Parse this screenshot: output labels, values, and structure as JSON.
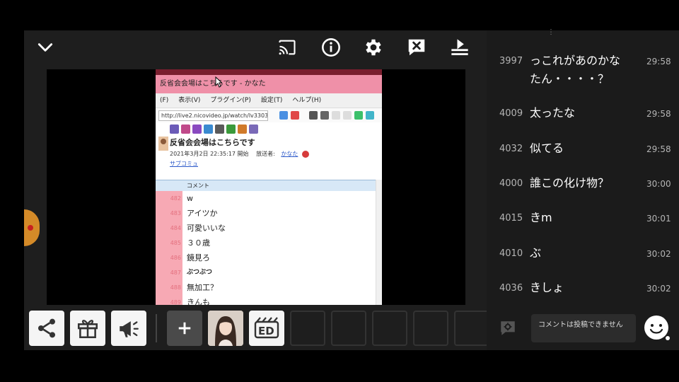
{
  "capture": {
    "window_title": "反省会会場はこちらです - かなた",
    "menu": [
      "(F)",
      "表示(V)",
      "プラグイン(P)",
      "設定(T)",
      "ヘルプ(H)"
    ],
    "url": "http://live2.nicovideo.jp/watch/lv330323",
    "live_title": "反省会会場はこちらです",
    "live_date": "2021年3月2日 22:35:17 開始",
    "broadcaster_label": "放送者:",
    "broadcaster_name": "かなた",
    "sub_link": "サブコミュ",
    "column_header": "コメント",
    "rows": [
      {
        "num": "482",
        "text": "w"
      },
      {
        "num": "483",
        "text": "アイツか"
      },
      {
        "num": "484",
        "text": "可愛いいな"
      },
      {
        "num": "485",
        "text": "３０歳"
      },
      {
        "num": "486",
        "text": "鏡見ろ"
      },
      {
        "num": "487",
        "text": "ぶつぶつ"
      },
      {
        "num": "488",
        "text": "無加工？"
      },
      {
        "num": "489",
        "text": "きんも"
      }
    ]
  },
  "comments": [
    {
      "no": "3997",
      "text": "っこれがあのかなたん・・・・？",
      "time": "29:58"
    },
    {
      "no": "4009",
      "text": "太ったな",
      "time": "29:58"
    },
    {
      "no": "4032",
      "text": "似てる",
      "time": "29:58"
    },
    {
      "no": "4000",
      "text": "誰この化け物？",
      "time": "30:00"
    },
    {
      "no": "4015",
      "text": "きm",
      "time": "30:01"
    },
    {
      "no": "4010",
      "text": "ぶ",
      "time": "30:02"
    },
    {
      "no": "4036",
      "text": "きしょ",
      "time": "30:02"
    }
  ],
  "comment_input_placeholder": "コメントは投稿できません",
  "ed_label": "ED",
  "colors": {
    "panel": "#1b1b1b",
    "capture_title": "#ef90a8",
    "capture_num": "#f7a9b4"
  },
  "icons": [
    "chevron-down-icon",
    "cast-icon",
    "info-icon",
    "gear-icon",
    "comment-off-icon",
    "stop-download-icon",
    "share-icon",
    "gift-icon",
    "megaphone-icon",
    "plus-icon",
    "ed-icon",
    "comment-settings-icon",
    "smiley-icon"
  ]
}
